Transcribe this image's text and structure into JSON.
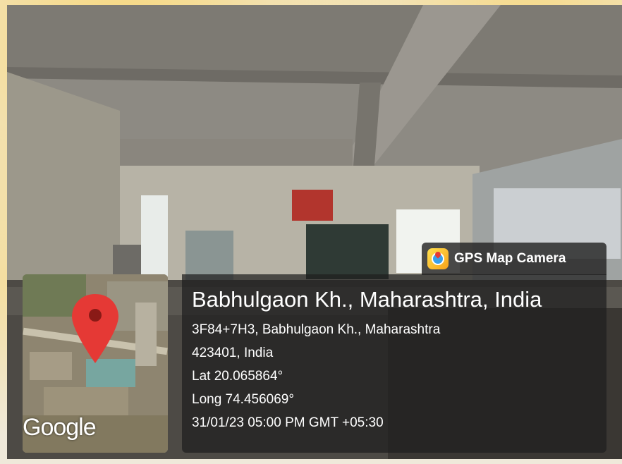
{
  "badge": {
    "label": "GPS Map Camera",
    "icon": "gps-map-camera-app-icon"
  },
  "map": {
    "logo": "Google",
    "pin_icon": "map-pin-icon",
    "pin_color": "#e53935"
  },
  "location": {
    "title": "Babhulgaon Kh., Maharashtra, India",
    "address_line1": "3F84+7H3, Babhulgaon Kh., Maharashtra",
    "address_line2": "423401, India",
    "latitude": "Lat 20.065864°",
    "longitude": "Long 74.456069°",
    "datetime": "31/01/23 05:00 PM GMT +05:30"
  },
  "colors": {
    "overlay": "#1e1e1e",
    "text": "#ffffff",
    "border_watermark": "#ffc828"
  }
}
